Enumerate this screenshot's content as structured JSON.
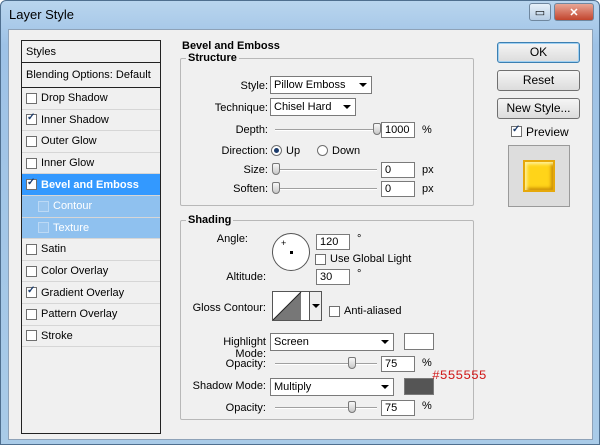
{
  "window": {
    "title": "Layer Style"
  },
  "styles_list": {
    "header": "Styles",
    "blending": "Blending Options: Default",
    "items": [
      {
        "label": "Drop Shadow",
        "checked": false
      },
      {
        "label": "Inner Shadow",
        "checked": true
      },
      {
        "label": "Outer Glow",
        "checked": false
      },
      {
        "label": "Inner Glow",
        "checked": false
      },
      {
        "label": "Bevel and Emboss",
        "checked": true
      },
      {
        "label": "Contour",
        "checked": false
      },
      {
        "label": "Texture",
        "checked": false
      },
      {
        "label": "Satin",
        "checked": false
      },
      {
        "label": "Color Overlay",
        "checked": false
      },
      {
        "label": "Gradient Overlay",
        "checked": true
      },
      {
        "label": "Pattern Overlay",
        "checked": false
      },
      {
        "label": "Stroke",
        "checked": false
      }
    ]
  },
  "bevel": {
    "title": "Bevel and Emboss",
    "structure": {
      "title": "Structure",
      "style_label": "Style:",
      "style_value": "Pillow Emboss",
      "technique_label": "Technique:",
      "technique_value": "Chisel Hard",
      "depth_label": "Depth:",
      "depth_value": "1000",
      "depth_unit": "%",
      "depth_level": 1.0,
      "direction_label": "Direction:",
      "dir_up": "Up",
      "dir_down": "Down",
      "size_label": "Size:",
      "size_value": "0",
      "size_unit": "px",
      "soften_label": "Soften:",
      "soften_value": "0",
      "soften_unit": "px"
    },
    "shading": {
      "title": "Shading",
      "angle_label": "Angle:",
      "angle_value": "120",
      "deg": "°",
      "global_light_label": "Use Global Light",
      "altitude_label": "Altitude:",
      "altitude_value": "30",
      "gloss_label": "Gloss Contour:",
      "anti_aliased_label": "Anti-aliased",
      "highlight_mode_label": "Highlight Mode:",
      "highlight_mode_value": "Screen",
      "highlight_color": "#ffffff",
      "hl_opacity_label": "Opacity:",
      "hl_opacity_value": "75",
      "hl_opacity_level": 0.75,
      "pct": "%",
      "shadow_mode_label": "Shadow Mode:",
      "shadow_mode_value": "Multiply",
      "shadow_color": "#555555",
      "sh_opacity_label": "Opacity:",
      "sh_opacity_value": "75",
      "sh_opacity_level": 0.75
    }
  },
  "buttons": {
    "ok": "OK",
    "reset": "Reset",
    "new_style": "New Style...",
    "preview_label": "Preview"
  },
  "annotation": "#555555"
}
